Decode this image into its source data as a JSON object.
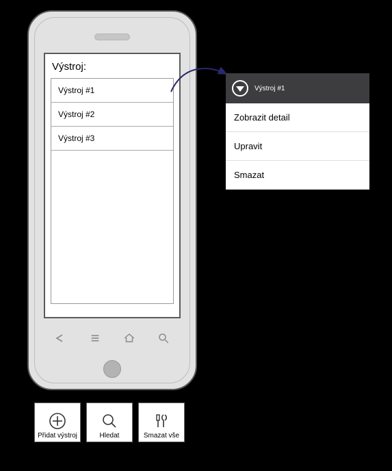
{
  "screen": {
    "title": "Výstroj:",
    "items": [
      {
        "label": "Výstroj #1"
      },
      {
        "label": "Výstroj #2"
      },
      {
        "label": "Výstroj #3"
      }
    ]
  },
  "popup": {
    "header": "Výstroj #1",
    "options": [
      {
        "label": "Zobrazit detail"
      },
      {
        "label": "Upravit"
      },
      {
        "label": "Smazat"
      }
    ]
  },
  "toolbar": {
    "add_label": "Přidat výstroj",
    "search_label": "Hledat",
    "delete_all_label": "Smazat vše"
  }
}
